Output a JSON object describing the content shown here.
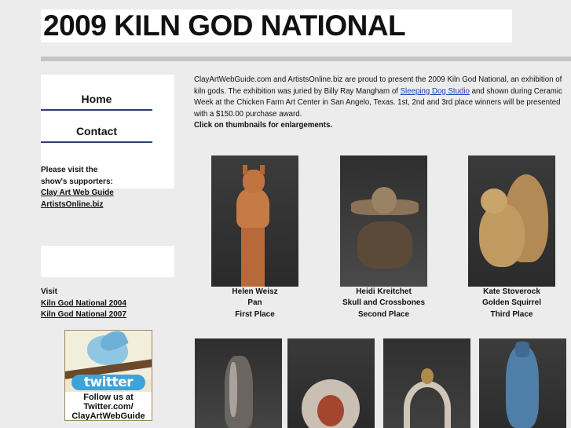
{
  "page": {
    "title": "2009 KILN GOD NATIONAL"
  },
  "nav": {
    "home": "Home",
    "contact": "Contact"
  },
  "supporters": {
    "line1": "Please visit the",
    "line2": "show's supporters:",
    "links": [
      "Clay Art Web Guide",
      "ArtistsOnline.biz"
    ]
  },
  "visit": {
    "label": "Visit",
    "links": [
      "Kiln God National 2004",
      "Kiln God National 2007"
    ]
  },
  "twitter": {
    "logo": "twitter",
    "line1": "Follow us at",
    "line2": "Twitter.com/",
    "line3": "ClayArtWebGuide"
  },
  "intro": {
    "text_before_link": "ClayArtWebGuide.com and ArtistsOnline.biz are proud to present the 2009 Kiln God National, an exhibition of kiln gods. The exhibition was juried by Billy Ray Mangham of ",
    "link": "Sleeping Dog Studio",
    "text_after_link": " and shown during Ceramic Week at the Chicken Farm Art Center in San Angelo, Texas. 1st, 2nd and 3rd place winners will be presented with a $150.00 purchase award.",
    "instruction": "Click on thumbnails for enlargements."
  },
  "winners": [
    {
      "artist": "Helen Weisz",
      "work": "Pan",
      "place": "First Place"
    },
    {
      "artist": "Heidi Kreitchet",
      "work": "Skull and Crossbones",
      "place": "Second Place"
    },
    {
      "artist": "Kate Stoverock",
      "work": "Golden Squirrel",
      "place": "Third Place"
    }
  ],
  "colors": {
    "page_bg": "#ececec",
    "panel_bg": "#ffffff",
    "rule": "#c4c4c4",
    "nav_underline": "#2c3f6e",
    "link_blue": "#1a3fb0"
  }
}
